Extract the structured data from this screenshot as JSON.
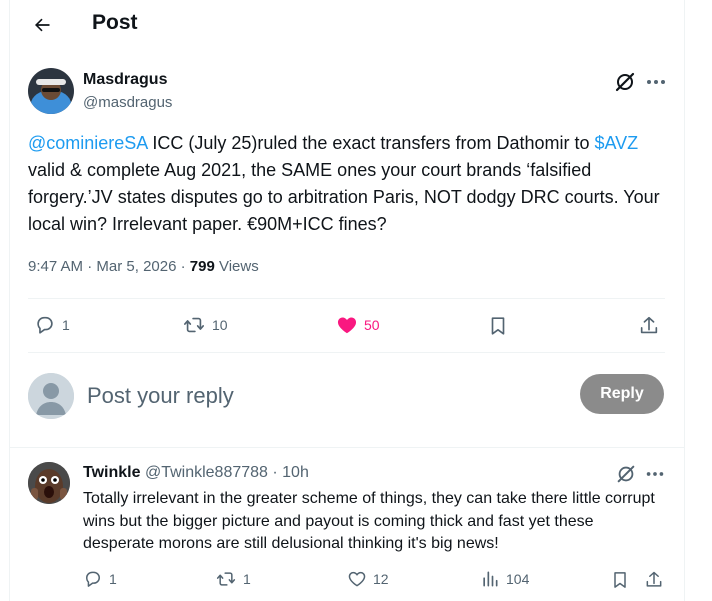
{
  "header": {
    "title": "Post"
  },
  "post": {
    "author_name": "Masdragus",
    "author_handle": "@masdragus",
    "mention": "@cominiereSA",
    "text_part1": " ICC (July 25)ruled the exact transfers from Dathomir to ",
    "cashtag": "$AVZ",
    "text_part2": " valid & complete Aug 2021, the SAME ones your court brands ‘falsified forgery.’JV states disputes go to arbitration Paris, NOT dodgy DRC courts. Your local win? Irrelevant paper. €90M+ICC fines?",
    "time": "9:47 AM",
    "sep1": " · ",
    "date": "Mar 5, 2026",
    "sep2": " · ",
    "views_count": "799",
    "views_label": " Views",
    "replies": "1",
    "reposts": "10",
    "likes": "50"
  },
  "composer": {
    "placeholder": "Post your reply",
    "button_label": "Reply"
  },
  "reply_tweet": {
    "name": "Twinkle",
    "handle": "@Twinkle887788",
    "sep": " · ",
    "age": "10h",
    "text": "Totally irrelevant in the greater scheme of things, they can take there little corrupt wins but the bigger picture and payout is coming thick and fast yet these desperate morons are still delusional thinking it's big news!",
    "replies": "1",
    "reposts": "1",
    "likes": "12",
    "views": "104"
  },
  "colors": {
    "link": "#1d9bf0",
    "like": "#f91880",
    "muted": "#536471",
    "reply_button": "#8b8b8b"
  }
}
